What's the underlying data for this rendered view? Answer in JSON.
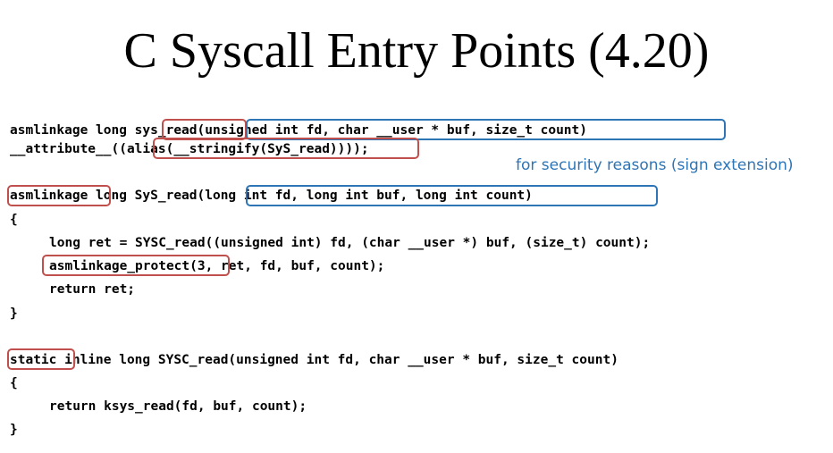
{
  "slide": {
    "title": "C Syscall Entry Points (4.20)",
    "note": "for security reasons (sign extension)",
    "code": {
      "l1": "asmlinkage long sys_read(unsigned int fd, char __user * buf, size_t count)",
      "l2": "__attribute__((alias(__stringify(SyS_read))));",
      "l3": "asmlinkage long SyS_read(long int fd, long int buf, long int count)",
      "l4": "{",
      "l5": "long ret = SYSC_read((unsigned int) fd, (char __user *) buf, (size_t) count);",
      "l6": "asmlinkage_protect(3, ret, fd, buf, count);",
      "l7": "return ret;",
      "l8": "}",
      "l9": "static inline long SYSC_read(unsigned int fd, char __user * buf, size_t count)",
      "l10": "{",
      "l11": "return ksys_read(fd, buf, count);",
      "l12": "}"
    },
    "highlight_colors": {
      "red": "#c0504d",
      "blue": "#2e75b6"
    }
  }
}
